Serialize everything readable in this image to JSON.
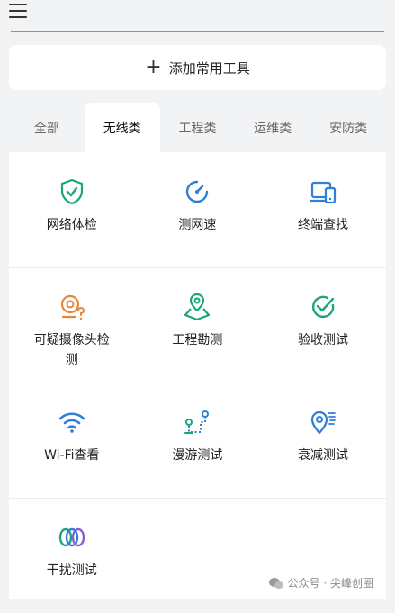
{
  "header": {
    "menu_icon": "menu-icon"
  },
  "add_tool": {
    "label": "添加常用工具",
    "icon": "plus-icon"
  },
  "tabs": [
    {
      "label": "全部",
      "active": false
    },
    {
      "label": "无线类",
      "active": true
    },
    {
      "label": "工程类",
      "active": false
    },
    {
      "label": "运维类",
      "active": false
    },
    {
      "label": "安防类",
      "active": false
    }
  ],
  "tools": {
    "network_check": {
      "label": "网络体检",
      "icon": "shield-check-icon"
    },
    "speed_test": {
      "label": "测网速",
      "icon": "speedometer-icon"
    },
    "device_finder": {
      "label": "终端查找",
      "icon": "devices-icon"
    },
    "camera_detect": {
      "label": "可疑摄像头检测",
      "icon": "camera-question-icon"
    },
    "site_survey": {
      "label": "工程勘测",
      "icon": "map-pin-icon"
    },
    "acceptance_test": {
      "label": "验收测试",
      "icon": "check-circle-icon"
    },
    "wifi_view": {
      "label": "Wi-Fi查看",
      "icon": "wifi-icon"
    },
    "roaming_test": {
      "label": "漫游测试",
      "icon": "roaming-path-icon"
    },
    "attenuation_test": {
      "label": "衰减测试",
      "icon": "signal-pin-icon"
    },
    "interference_test": {
      "label": "干扰测试",
      "icon": "interference-rings-icon"
    }
  },
  "watermark": {
    "text": "公众号 · 尖峰创圈",
    "icon": "wechat-icon"
  },
  "colors": {
    "green": "#1aa57a",
    "blue": "#2f7fd6",
    "orange": "#e8873a",
    "purple": "#8a5cd6"
  }
}
